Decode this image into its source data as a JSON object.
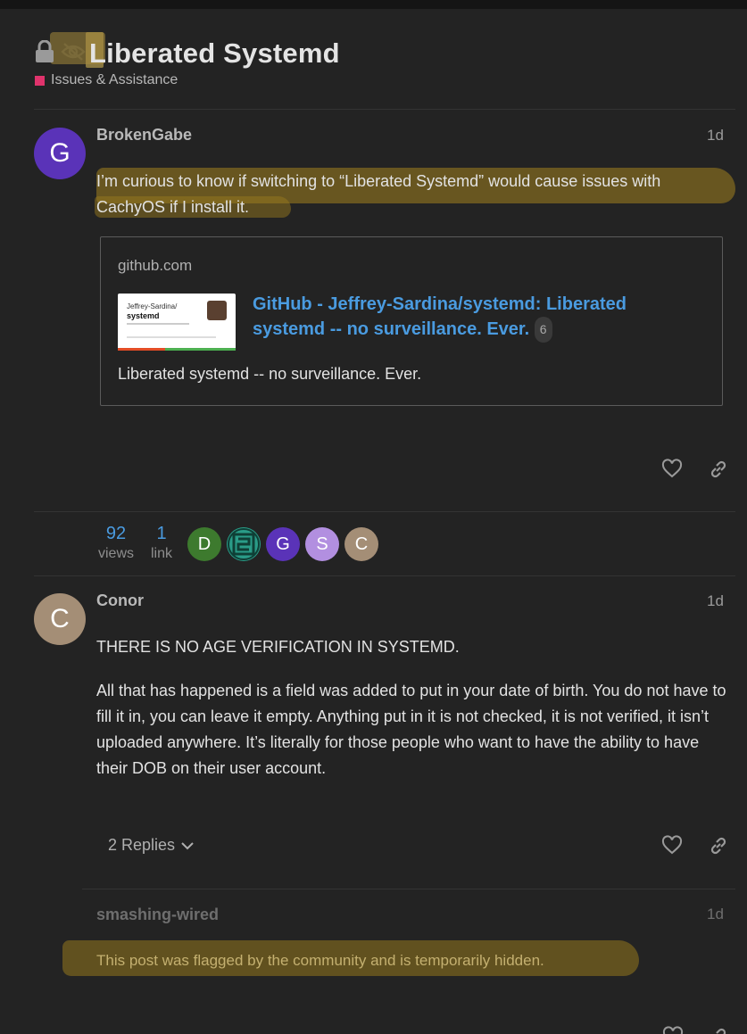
{
  "topic": {
    "title": "Liberated Systemd",
    "category": "Issues & Assistance",
    "category_color": "#e0336c"
  },
  "posts": [
    {
      "avatar_letter": "G",
      "avatar_color": "#5a33b8",
      "username": "BrokenGabe",
      "age": "1d",
      "text": "I’m curious to know if switching to “Liberated Systemd” would cause issues with CachyOS if I install it.",
      "onebox": {
        "domain": "github.com",
        "thumb_owner": "Jeffrey-Sardina/",
        "thumb_repo": "systemd",
        "title": "GitHub - Jeffrey-Sardina/systemd: Liberated systemd -- no surveillance. Ever.",
        "count": "6",
        "description": "Liberated systemd -- no surveillance. Ever."
      }
    },
    {
      "avatar_letter": "C",
      "avatar_color": "#a48e76",
      "username": "Conor",
      "age": "1d",
      "paragraphs": [
        "THERE IS NO AGE VERIFICATION IN SYSTEMD.",
        "All that has happened is a field was added to put in your date of birth. You do not have to fill it in, you can leave it empty. Anything put in it is not checked, it is not verified, it isn’t uploaded anywhere. It’s literally for those people who want to have the ability to have their DOB on their user account."
      ],
      "replies_label": "2 Replies"
    },
    {
      "username": "smashing-wired",
      "age": "1d",
      "hidden_text": "This post was flagged by the community and is temporarily hidden."
    }
  ],
  "topic_map": {
    "views": "92",
    "views_label": "views",
    "links": "1",
    "links_label": "link",
    "participants": [
      {
        "letter": "D",
        "color": "#3d7a2e"
      },
      {
        "letter": "",
        "color": "#2a9c88"
      },
      {
        "letter": "G",
        "color": "#5a33b8"
      },
      {
        "letter": "S",
        "color": "#b28fe0"
      },
      {
        "letter": "C",
        "color": "#a48e76"
      }
    ]
  },
  "colors": {
    "background": "#232323",
    "link_blue": "#4a9be0",
    "highlight": "#96781e"
  },
  "icons": [
    "lock-icon",
    "eye-slash-icon",
    "heart-icon",
    "link-icon",
    "chevron-down-icon"
  ]
}
